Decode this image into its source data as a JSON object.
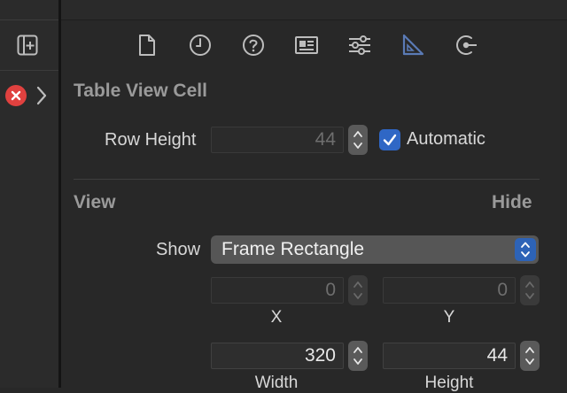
{
  "inspector_tabs": [
    {
      "name": "file-inspector",
      "icon": "document-icon"
    },
    {
      "name": "history-inspector",
      "icon": "clock-icon"
    },
    {
      "name": "quick-help-inspector",
      "icon": "question-icon"
    },
    {
      "name": "identity-inspector",
      "icon": "identity-card-icon"
    },
    {
      "name": "attributes-inspector",
      "icon": "sliders-icon"
    },
    {
      "name": "size-inspector",
      "icon": "ruler-triangle-icon",
      "selected": true
    },
    {
      "name": "connections-inspector",
      "icon": "connection-arrow-icon"
    }
  ],
  "table_view_cell": {
    "title": "Table View Cell",
    "row_height_label": "Row Height",
    "row_height_value": "44",
    "automatic_label": "Automatic",
    "automatic_checked": true
  },
  "view": {
    "title": "View",
    "hide_label": "Hide",
    "show_label": "Show",
    "show_selected": "Frame Rectangle",
    "x_value": "0",
    "x_label": "X",
    "y_value": "0",
    "y_label": "Y",
    "width_value": "320",
    "width_label": "Width",
    "height_value": "44",
    "height_label": "Height"
  },
  "colors": {
    "accent": "#2f67c5",
    "error": "#e0413f",
    "selected_tab": "#5a7ab5"
  }
}
